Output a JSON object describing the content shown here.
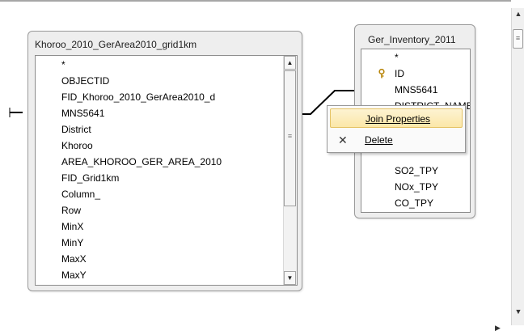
{
  "table1": {
    "title": "Khoroo_2010_GerArea2010_grid1km",
    "fields": [
      "*",
      "OBJECTID",
      "FID_Khoroo_2010_GerArea2010_d",
      "MNS5641",
      "District",
      "Khoroo",
      "AREA_KHOROO_GER_AREA_2010",
      "FID_Grid1km",
      "Column_",
      "Row",
      "MinX",
      "MinY",
      "MaxX",
      "MaxY"
    ],
    "scroll_up_icon": "up-arrow",
    "scroll_down_icon": "down-arrow"
  },
  "table2": {
    "title": "Ger_Inventory_2011",
    "fields": [
      "*",
      "ID",
      "MNS5641",
      "DISTRICT_NAME",
      "SO2_TPY",
      "NOx_TPY",
      "CO_TPY"
    ],
    "key_field": "ID",
    "key_icon": "primary-key-icon"
  },
  "context_menu": {
    "items": [
      {
        "label": "Join Properties",
        "icon": "",
        "highlighted": true
      },
      {
        "label": "Delete",
        "icon": "delete-x-icon",
        "highlighted": false
      }
    ]
  },
  "colors": {
    "highlight": "#fbe7a8",
    "window_bg": "#eeeeee",
    "line": "#000000"
  }
}
